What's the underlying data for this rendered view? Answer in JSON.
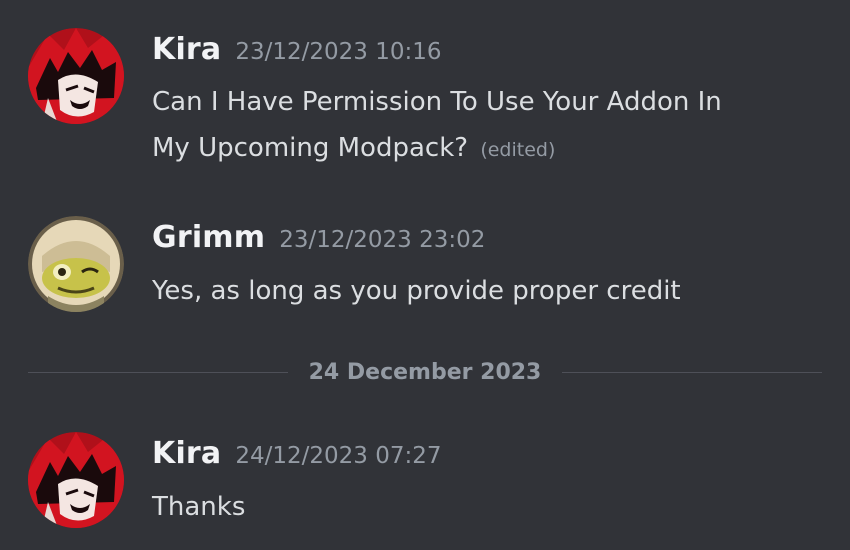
{
  "messages": [
    {
      "username": "Kira",
      "timestamp": "23/12/2023 10:16",
      "line1": "Can I Have Permission To Use Your Addon In",
      "line2": "My Upcoming Modpack?",
      "edited": "(edited)",
      "avatar_icon": "anime-red-hair-avatar"
    },
    {
      "username": "Grimm",
      "timestamp": "23/12/2023 23:02",
      "text": "Yes, as long as you provide proper credit",
      "avatar_icon": "frog-face-avatar"
    },
    {
      "username": "Kira",
      "timestamp": "24/12/2023 07:27",
      "text": "Thanks",
      "avatar_icon": "anime-red-hair-avatar"
    }
  ],
  "date_divider": "24 December 2023",
  "colors": {
    "background": "#313338",
    "username": "#f2f3f5",
    "timestamp": "#949ba4",
    "message_text": "#dbdee1",
    "divider_line": "#4e5058"
  }
}
